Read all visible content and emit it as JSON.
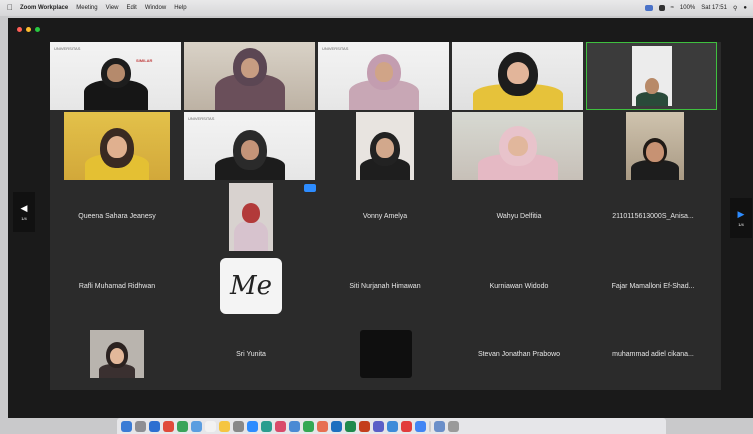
{
  "menubar": {
    "apple": "",
    "items": [
      "Zoom Workplace",
      "Meeting",
      "View",
      "Edit",
      "Window",
      "Help"
    ],
    "right": [
      "100%",
      "Sat 17:51"
    ]
  },
  "event_logo": "UNIVERSITAS",
  "event_badge": "SIMILAR",
  "tiles_named": [
    "Queena Sahara Jeanesy",
    "Vonny Amelya",
    "Wahyu Delfitia",
    "2110115613000S_Anisa...",
    "Rafli Muhamad Ridhwan",
    "Siti Nurjanah Himawan",
    "Kurniawan Widodo",
    "Fajar Mamalloni Ef-Shad...",
    "Sri Yunita",
    "Stevan Jonathan Prabowo",
    "muhammad adiel cikana..."
  ],
  "me_avatar": "Me",
  "nav": {
    "prev_page": "1/4",
    "next_page": "1/4"
  },
  "colors": {
    "speaking_border": "#3fbf3f",
    "window_bg": "#1a1a1a",
    "tile_bg": "#2b2b2b",
    "accent": "#2d8cff"
  }
}
